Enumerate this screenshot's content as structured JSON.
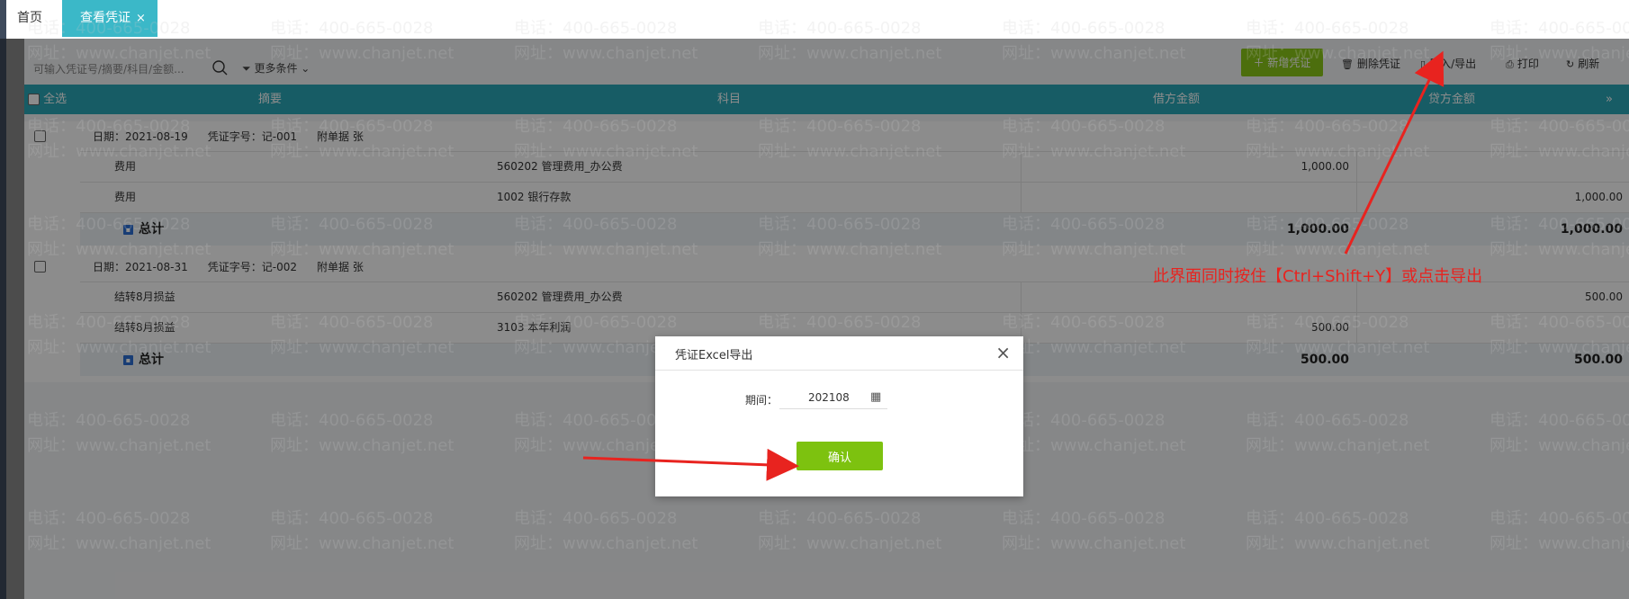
{
  "tabs": {
    "home": "首页",
    "active": "查看凭证",
    "close": "×"
  },
  "search": {
    "placeholder": "可输入凭证号/摘要/科目/金额..."
  },
  "filter": {
    "label": "更多条件"
  },
  "toolbar": {
    "add": "新增凭证",
    "delete": "删除凭证",
    "import_export": "导入/导出",
    "print": "打印",
    "refresh": "刷新"
  },
  "table": {
    "select_all": "全选",
    "col_summary": "摘要",
    "col_subject": "科目",
    "col_debit": "借方金额",
    "col_credit": "贷方金额"
  },
  "vouchers": [
    {
      "date": "日期：2021-08-19",
      "number": "凭证字号：记-001",
      "attach": "附单据  张",
      "rows": [
        {
          "summary": "费用",
          "subject": "560202 管理费用_办公费",
          "debit": "1,000.00",
          "credit": ""
        },
        {
          "summary": "费用",
          "subject": "1002 银行存款",
          "debit": "",
          "credit": "1,000.00"
        }
      ],
      "total_label": "总计",
      "total_debit": "1,000.00",
      "total_credit": "1,000.00"
    },
    {
      "date": "日期：2021-08-31",
      "number": "凭证字号：记-002",
      "attach": "附单据  张",
      "rows": [
        {
          "summary": "结转8月损益",
          "subject": "560202 管理费用_办公费",
          "debit": "",
          "credit": "500.00"
        },
        {
          "summary": "结转8月损益",
          "subject": "3103 本年利润",
          "debit": "500.00",
          "credit": ""
        }
      ],
      "total_label": "总计",
      "total_debit": "500.00",
      "total_credit": "500.00"
    }
  ],
  "watermark": {
    "line1": "电话：400-665-0028",
    "line2": "网址：www.chanjet.net"
  },
  "modal": {
    "title": "凭证Excel导出",
    "close": "×",
    "period_label": "期间：",
    "period_value": "202108",
    "confirm": "确认"
  },
  "annotation": "此界面同时按住【Ctrl+Shift+Y】或点击导出",
  "colors": {
    "accent": "#2aa8b8",
    "button_green": "#8bc819",
    "annotation_red": "#e8231f"
  }
}
